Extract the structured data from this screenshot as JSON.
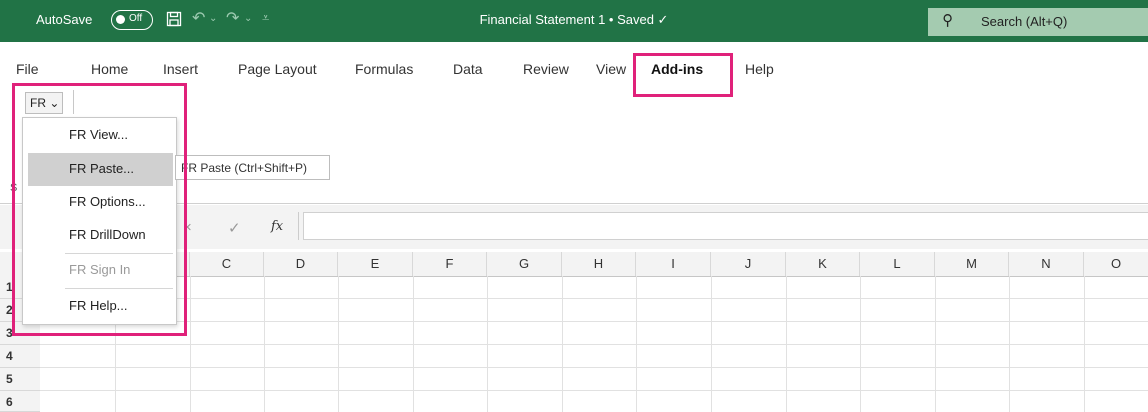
{
  "titlebar": {
    "autosave_label": "AutoSave",
    "autosave_state": "Off",
    "document_title": "Financial Statement 1 • Saved ✓",
    "search_placeholder": "Search (Alt+Q)",
    "quick_access": [
      "save-icon",
      "undo-icon",
      "redo-icon",
      "customize-icon"
    ],
    "bg_color": "#217346"
  },
  "tabs": [
    "File",
    "Home",
    "Insert",
    "Page Layout",
    "Formulas",
    "Data",
    "Review",
    "View",
    "Add-ins",
    "Help"
  ],
  "active_tab": "Add-ins",
  "ribbon": {
    "fr_button": "FR ⌄",
    "group_label_partial": "S"
  },
  "menu": {
    "items": [
      {
        "label": "FR View...",
        "state": "normal"
      },
      {
        "label": "FR Paste...",
        "state": "selected"
      },
      {
        "label": "FR Options...",
        "state": "normal"
      },
      {
        "label": "FR DrillDown",
        "state": "normal"
      },
      {
        "label": "FR Sign In",
        "state": "disabled"
      },
      {
        "label": "FR Help...",
        "state": "normal"
      }
    ]
  },
  "tooltip": "FR Paste (Ctrl+Shift+P)",
  "formula_bar": {
    "cancel": "×",
    "enter": "✓",
    "fx": "fx"
  },
  "columns": [
    "C",
    "D",
    "E",
    "F",
    "G",
    "H",
    "I",
    "J",
    "K",
    "L",
    "M",
    "N",
    "O"
  ],
  "rows": [
    "1",
    "2",
    "3",
    "4",
    "5",
    "6"
  ],
  "highlight_color": "#e0217a"
}
